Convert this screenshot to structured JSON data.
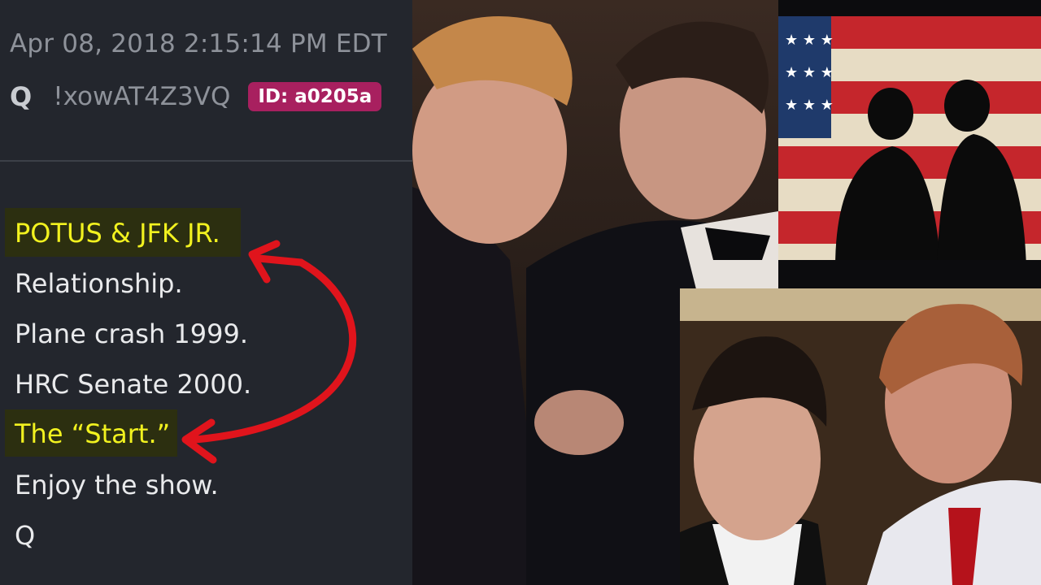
{
  "post": {
    "timestamp": "Apr 08, 2018 2:15:14 PM EDT",
    "author": "Q",
    "tripcode": "!xowAT4Z3VQ",
    "id_badge": "ID: a0205a",
    "lines": [
      "POTUS & JFK JR.",
      "Relationship.",
      "Plane crash 1999.",
      "HRC Senate 2000.",
      "The “Start.”",
      "Enjoy the show.",
      "Q"
    ]
  },
  "colors": {
    "panel_bg": "#23262d",
    "highlight_text": "#f2f21f",
    "id_badge": "#a8205f",
    "arrow": "#e0141c"
  },
  "images": {
    "main_photo": "two men in tuxedos shaking hands",
    "flag_silhouette": "silhouettes of two men over a distressed american flag",
    "bottom_photo": "two men in suits posing together"
  }
}
